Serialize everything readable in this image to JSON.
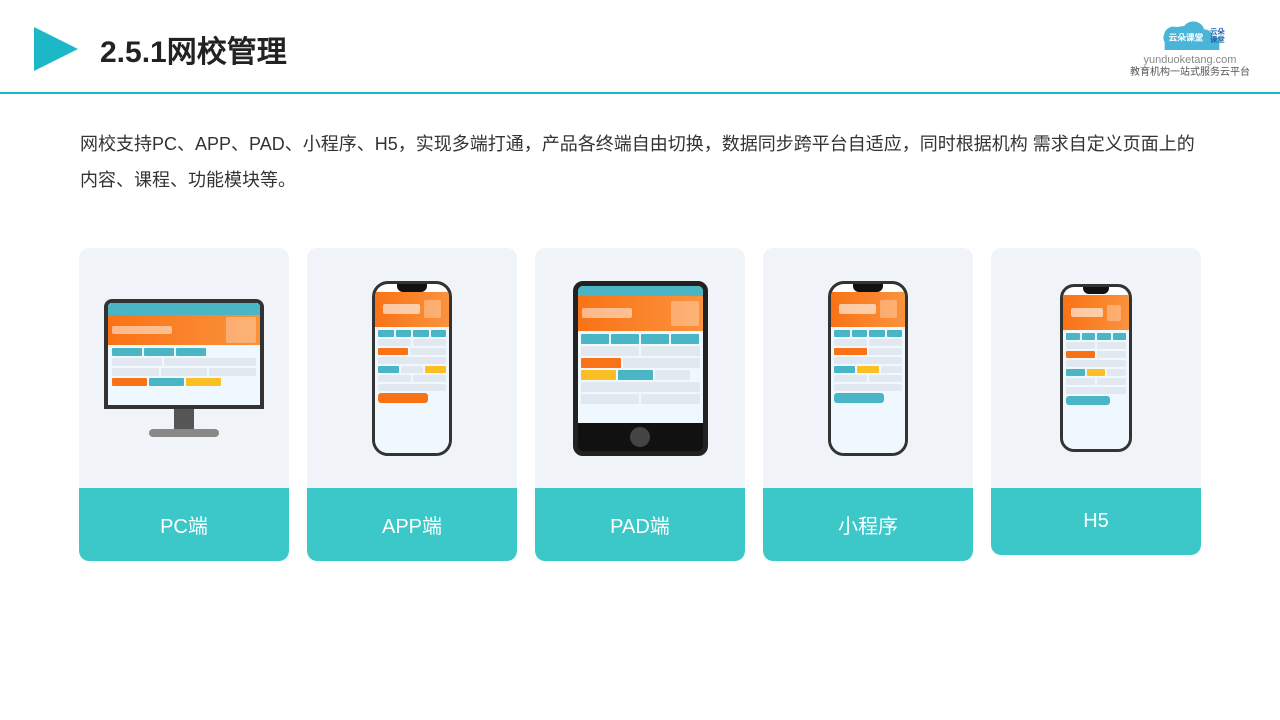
{
  "header": {
    "title": "2.5.1网校管理",
    "logo_name": "云朵课堂",
    "logo_url": "yunduoketang.com",
    "logo_slogan": "教育机构一站\n式服务云平台"
  },
  "description": {
    "text": "网校支持PC、APP、PAD、小程序、H5，实现多端打通，产品各终端自由切换，数据同步跨平台自适应，同时根据机构\n需求自定义页面上的内容、课程、功能模块等。"
  },
  "cards": [
    {
      "id": "pc",
      "label": "PC端"
    },
    {
      "id": "app",
      "label": "APP端"
    },
    {
      "id": "pad",
      "label": "PAD端"
    },
    {
      "id": "miniprogram",
      "label": "小程序"
    },
    {
      "id": "h5",
      "label": "H5"
    }
  ],
  "colors": {
    "teal": "#3cc8c8",
    "accent_line": "#1db8c8",
    "orange": "#f97316",
    "text_dark": "#222",
    "text_body": "#333",
    "card_bg": "#f0f4f8"
  }
}
